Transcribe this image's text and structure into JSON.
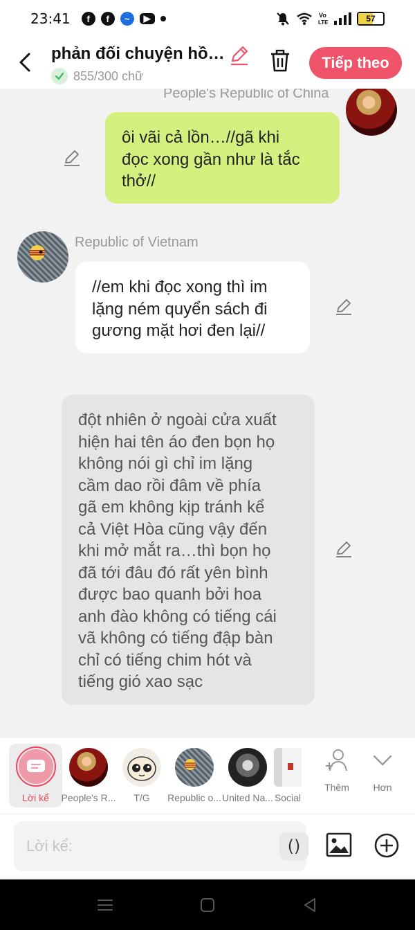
{
  "status_bar": {
    "time": "23:41",
    "battery": "57",
    "battery_level": 0.57,
    "app_icons": [
      "facebook-icon",
      "facebook-icon",
      "messenger-icon",
      "youtube-icon",
      "notification-dot-icon"
    ],
    "right_icons": [
      "bell-muted-icon",
      "wifi-icon",
      "volte-icon",
      "signal-icon",
      "battery-icon"
    ]
  },
  "header": {
    "title": "phản đối chuyện hồ…",
    "word_count": "855/300 chữ",
    "next_label": "Tiếp theo",
    "accent": "#f0546a"
  },
  "messages": [
    {
      "type": "outgoing",
      "speaker": "People's Republic of China",
      "text": "ôi vãi cả lồn…//gã khi\nđọc xong gần như là tắc\nthở//",
      "color": "#d4f07f"
    },
    {
      "type": "incoming",
      "speaker": "Republic of Vietnam",
      "text": "//em khi đọc xong thì im\nlặng ném quyển sách đi\ngương mặt hơi đen lại//",
      "color": "#ffffff"
    },
    {
      "type": "narration",
      "text": "đột nhiên ở ngoài cửa xuất\nhiện hai tên áo đen bọn họ\nkhông nói gì chỉ im lặng\ncầm dao rồi đâm về phía\ngã em không kịp tránh kể\ncả Việt Hòa cũng vậy đến\nkhi mở mắt ra…thì bọn họ\nđã tới đâu đó rất yên bình\nđược bao quanh bởi hoa\nanh đào không có tiếng cái\nvã không có tiếng đập bàn\nchỉ có tiếng chim hót và\ntiếng gió xao sạc",
      "color": "#e5e5e5"
    }
  ],
  "characters": [
    {
      "label": "Lời kể",
      "active": true
    },
    {
      "label": "People's R..."
    },
    {
      "label": "T/G"
    },
    {
      "label": "Republic o..."
    },
    {
      "label": "United Na..."
    },
    {
      "label": "Social"
    }
  ],
  "actions": {
    "add_label": "Thêm",
    "more_label": "Hơn"
  },
  "input": {
    "placeholder": "Lời kể:",
    "paren_label": "()"
  }
}
